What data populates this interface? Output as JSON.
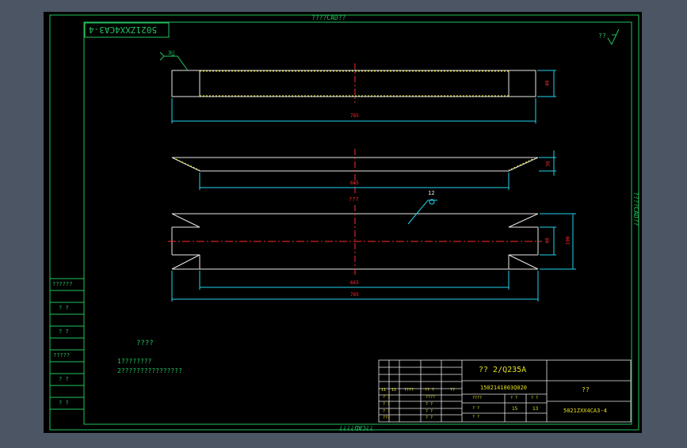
{
  "colors": {
    "viewport_bg": "#4b5563",
    "canvas_bg": "#000000",
    "frame": "#22c55e",
    "outline": "#e8e8e8",
    "dimension": "#22d3ee",
    "centerline": "#ff2a2a",
    "hatch": "#e5e020",
    "note_text": "#22c55e"
  },
  "border": {
    "top_label": "????CAD??",
    "bottom_label": "??CAD????",
    "right_label": "????CAD??",
    "drawing_code_flipped": "5021ZXX4CA3-4"
  },
  "roughness_symbol": {
    "label": "??",
    "icon": "surface-roughness-icon"
  },
  "weld_callout": {
    "label": "3∐"
  },
  "views": {
    "top": {
      "dim_length": "785",
      "dim_height": "40"
    },
    "middle": {
      "dim_bottom": "665",
      "dim_height": "30"
    },
    "bottom": {
      "dim_inner": "665",
      "dim_total": "785",
      "dim_height_inner": "40",
      "dim_height_outer": "100",
      "view_label": "???",
      "callout_label": "12"
    }
  },
  "left_column": [
    "??????",
    "? ?",
    "? ?",
    "?????",
    "? ?",
    "? ?"
  ],
  "notes": {
    "title": "????",
    "line1": "1????????",
    "line2": "2????????????????"
  },
  "title_block": {
    "material": "?? 2/Q235A",
    "code": "1502141003Q020",
    "scale_label": "??",
    "drawing_no": "5021ZXX4CA3-4",
    "sheet_a": "15",
    "sheet_b": "13",
    "row_labels": [
      "11",
      "11",
      "????",
      "?? ?",
      "??",
      "? ?",
      "? ?",
      "????",
      "? ?",
      "? ?",
      "? ?",
      "???",
      "? ?",
      "? ?",
      "????",
      "?  ?",
      "?  ?",
      "?  ?"
    ]
  }
}
